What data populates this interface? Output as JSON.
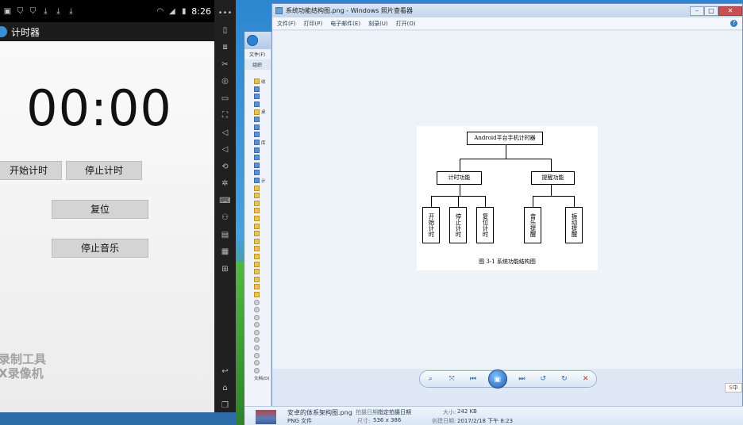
{
  "emulator": {
    "status_bar": {
      "time": "8:26"
    },
    "app_title": "计时器",
    "timer_display": "00:00",
    "buttons": {
      "start": "开始计时",
      "stop": "停止计时",
      "reset": "复位",
      "stop_music": "停止音乐"
    },
    "watermark": [
      "录制工具",
      "X录像机"
    ]
  },
  "viewer": {
    "title": "系统功能结构图.png - Windows 照片查看器",
    "menu": [
      "文件(F)",
      "打印(P)",
      "电子邮件(E)",
      "刻录(U)",
      "打开(O)"
    ],
    "diagram": {
      "root": "Android平台手机计时器",
      "branches": [
        {
          "label": "计时功能",
          "children": [
            "开始计时",
            "停止计时",
            "复位计时"
          ]
        },
        {
          "label": "提醒功能",
          "children": [
            "音乐提醒",
            "振动提醒"
          ]
        }
      ],
      "caption": "图 3-1 系统功能结构图"
    }
  },
  "explorer": {
    "menu": "文件(F)",
    "organize": "组织",
    "tree_labels": [
      "收",
      "桌",
      "库",
      "计",
      "文档(D)"
    ]
  },
  "details": {
    "filename": "安卓的体系架构图.png",
    "date_taken_label": "拍摄日期:",
    "date_taken_value": "指定拍摄日期",
    "size_label": "大小:",
    "size_value": "242 KB",
    "type": "PNG 文件",
    "dimensions_label": "尺寸:",
    "dimensions_value": "536 x 386",
    "created_label": "创建日期:",
    "created_value": "2017/2/18 下午 8:23"
  },
  "tray": {
    "badge": "S",
    "ime": "中"
  }
}
